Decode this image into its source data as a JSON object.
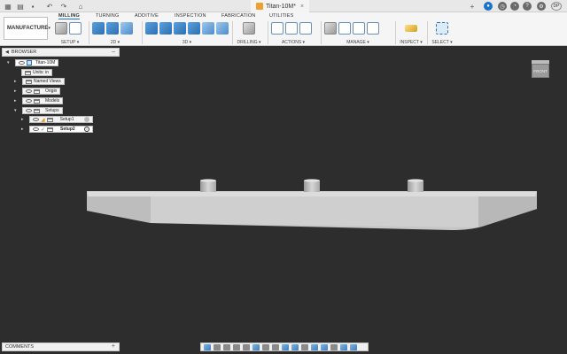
{
  "titlebar": {
    "document_title": "Titan-10M*",
    "user_initials": "DP"
  },
  "ribbon": {
    "workspace": "MANUFACTURE",
    "tabs": [
      "MILLING",
      "TURNING",
      "ADDITIVE",
      "INSPECTION",
      "FABRICATION",
      "UTILITIES"
    ],
    "active_tab": "MILLING",
    "groups": {
      "setup": "SETUP ▾",
      "twod": "2D ▾",
      "threed": "3D ▾",
      "drilling": "DRILLING ▾",
      "actions": "ACTIONS ▾",
      "manage": "MANAGE ▾",
      "inspect": "INSPECT ▾",
      "select": "SELECT ▾"
    }
  },
  "browser": {
    "title": "BROWSER",
    "root": "Titan-10M",
    "units": "Units: in",
    "named_views": "Named Views",
    "origin": "Origin",
    "models": "Models",
    "setups": "Setups",
    "setup1": "Setup1",
    "setup2": "Setup2"
  },
  "viewcube": {
    "face_label": "FRONT"
  },
  "comments": {
    "title": "COMMENTS"
  },
  "colors": {
    "accent": "#1a73c8",
    "canvas": "#2d2d2d",
    "model": "#c9c9c9"
  }
}
